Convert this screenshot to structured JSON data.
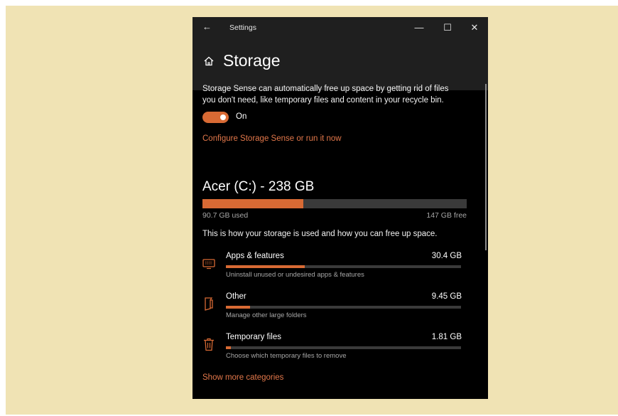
{
  "window": {
    "title": "Settings",
    "back_icon": "back-arrow-icon",
    "minimize": "—",
    "maximize": "☐",
    "close": "✕"
  },
  "header": {
    "home_icon": "home-icon",
    "title": "Storage"
  },
  "storage_sense": {
    "description_line1": "Storage Sense can automatically free up space by getting rid of files",
    "description_line2": "you don't need, like temporary files and content in your recycle bin.",
    "toggle_state": "On",
    "toggle_on": true,
    "configure_link": "Configure Storage Sense or run it now"
  },
  "drive": {
    "title": "Acer (C:) - 238 GB",
    "used_label": "90.7 GB used",
    "free_label": "147 GB free",
    "used_fraction": 0.381,
    "summary": "This is how your storage is used and how you can free up space."
  },
  "categories": [
    {
      "icon": "keyboard-icon",
      "name": "Apps & features",
      "size": "30.4 GB",
      "description": "Uninstall unused or undesired apps & features",
      "fraction": 0.335
    },
    {
      "icon": "folder-icon",
      "name": "Other",
      "size": "9.45 GB",
      "description": "Manage other large folders",
      "fraction": 0.104
    },
    {
      "icon": "trash-icon",
      "name": "Temporary files",
      "size": "1.81 GB",
      "description": "Choose which temporary files to remove",
      "fraction": 0.02
    }
  ],
  "show_more_link": "Show more categories",
  "colors": {
    "accent": "#d86a34",
    "link": "#e2774a",
    "window_bg": "#000000",
    "header_bg": "#1f1f1f",
    "page_bg": "#f0e3b4"
  }
}
